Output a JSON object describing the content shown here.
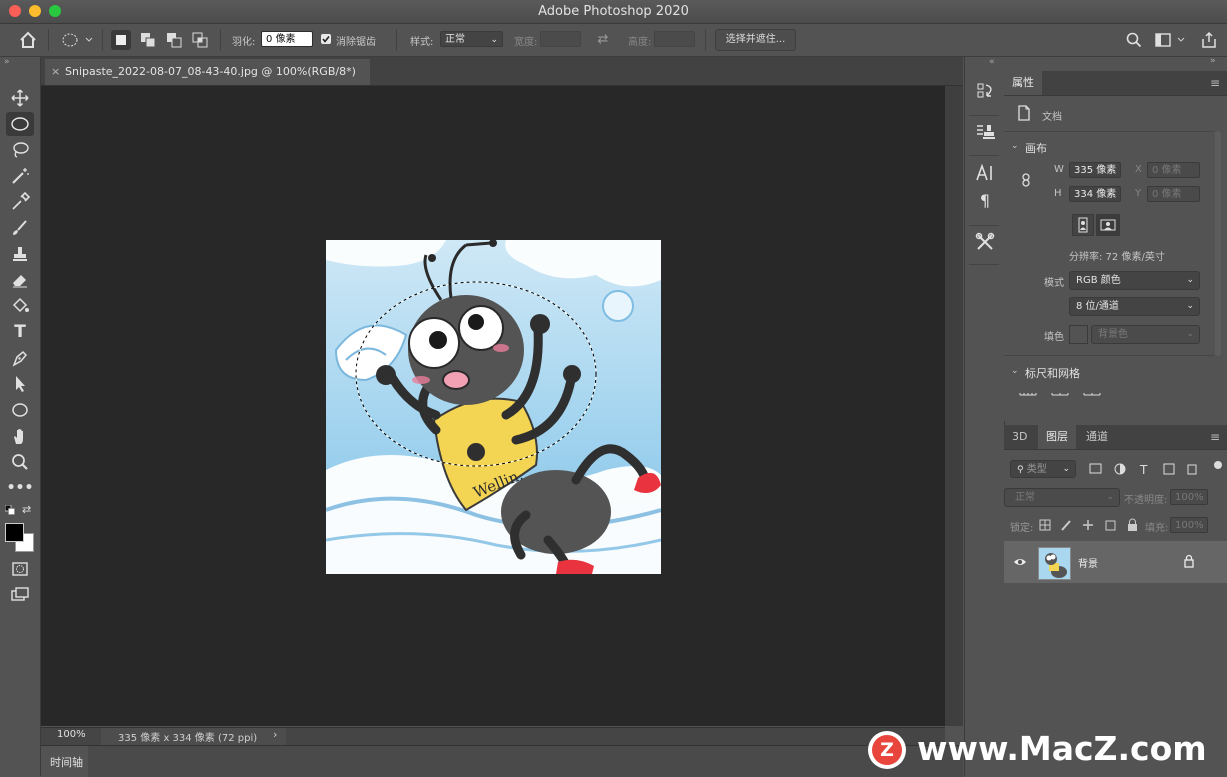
{
  "window": {
    "title": "Adobe Photoshop 2020"
  },
  "options_bar": {
    "feather_label": "羽化:",
    "feather_value": "0 像素",
    "antialias_label": "消除锯齿",
    "style_label": "样式:",
    "style_value": "正常",
    "width_label": "宽度:",
    "height_label": "高度:",
    "select_mask_button": "选择并遮住..."
  },
  "document": {
    "tab_title": "Snipaste_2022-08-07_08-43-40.jpg @ 100%(RGB/8*)",
    "zoom": "100%",
    "status_info": "335 像素 x 334 像素 (72 ppi)",
    "artwork_text": "Wellin."
  },
  "timeline": {
    "label": "时间轴"
  },
  "properties_panel": {
    "tab": "属性",
    "doc_label": "文档",
    "canvas_section": "画布",
    "w_label": "W",
    "w_value": "335 像素",
    "h_label": "H",
    "h_value": "334 像素",
    "x_label": "X",
    "x_placeholder": "0 像素",
    "y_label": "Y",
    "y_placeholder": "0 像素",
    "resolution": "分辨率: 72 像素/英寸",
    "mode_label": "模式",
    "mode_value": "RGB 颜色",
    "depth_value": "8 位/通道",
    "fill_label": "填色",
    "fill_value": "背景色",
    "rulers_section": "标尺和网格"
  },
  "layers_panel": {
    "tabs": [
      "3D",
      "图层",
      "通道"
    ],
    "filter_kind": "类型",
    "blend_mode": "正常",
    "opacity_label": "不透明度:",
    "opacity_value": "100%",
    "lock_label": "锁定:",
    "fill_label": "填充:",
    "fill_value": "100%",
    "layers": [
      {
        "name": "背景"
      }
    ]
  },
  "watermark": {
    "text": "www.MacZ.com",
    "badge": "Z"
  },
  "colors": {
    "foreground": "#000000",
    "background": "#ffffff"
  }
}
